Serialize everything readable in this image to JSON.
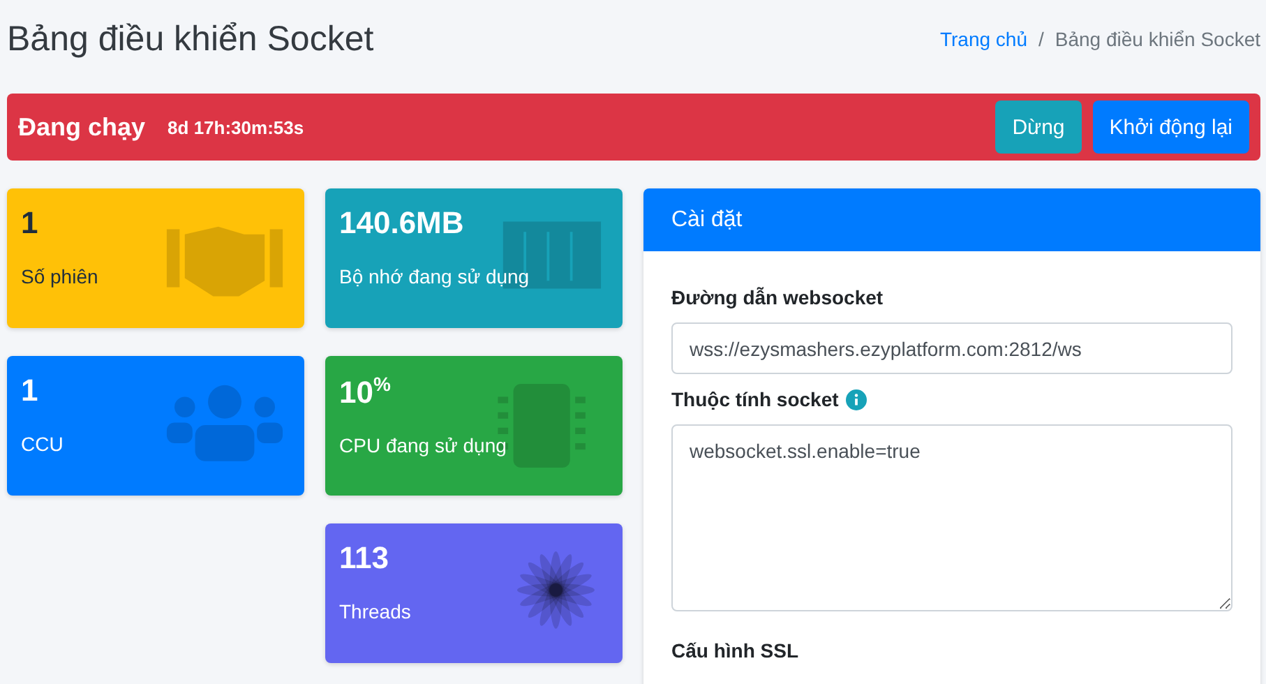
{
  "page_title": "Bảng điều khiển Socket",
  "breadcrumb_separator": "/",
  "breadcrumb": [
    {
      "label": "Trang chủ",
      "link": true
    },
    {
      "label": "Bảng điều khiển Socket",
      "link": false
    }
  ],
  "status_bar": {
    "status": "Đang chạy",
    "uptime": "8d 17h:30m:53s",
    "running": true,
    "buttons": [
      {
        "label": "Dừng",
        "color": "#17a2b8"
      },
      {
        "label": "Khởi động lại",
        "color": "#007bff"
      }
    ]
  },
  "stat_columns": [
    [
      {
        "kind": "sessions",
        "value": "1",
        "label": "Số phiên",
        "color": "#ffc107"
      },
      {
        "kind": "ccu",
        "value": "1",
        "label": "CCU",
        "color": "#007bff"
      }
    ],
    [
      {
        "kind": "memory",
        "value": "140.6MB",
        "label": "Bộ nhớ đang sử dụng",
        "color": "#17a2b8"
      },
      {
        "kind": "cpu",
        "value": "10$^{%}$",
        "label": "CPU đang sử dụng",
        "color": "#28a745"
      },
      {
        "kind": "threads",
        "value": "113",
        "label": "Threads",
        "color": "#6366f1"
      }
    ]
  ],
  "settings": {
    "title": "Cài đặt",
    "fields": [
      {
        "kind": "input",
        "label": "Đường dẫn websocket",
        "value": "wss://ezysmashers.ezyplatform.com:2812/ws"
      },
      {
        "kind": "textarea",
        "label": "Thuộc tính socket",
        "info": true,
        "value": "websocket.ssl.enable=true"
      },
      {
        "kind": "heading",
        "label": "Cấu hình SSL"
      }
    ]
  }
}
